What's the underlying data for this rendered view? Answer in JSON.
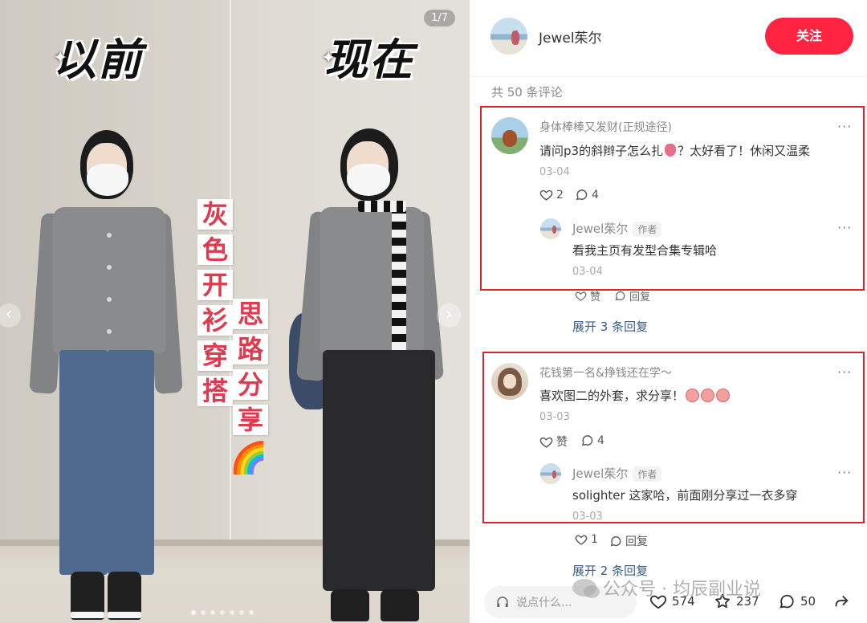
{
  "image": {
    "label_left": "以前",
    "label_right": "现在",
    "counter": "1/7",
    "vertical_col1": [
      "灰",
      "色",
      "开",
      "衫",
      "穿",
      "搭"
    ],
    "vertical_col2": [
      "思",
      "路",
      "分",
      "享"
    ],
    "rainbow": "🌈",
    "prev_arrow": "‹",
    "next_arrow": "›"
  },
  "header": {
    "author": "Jewel茱尔",
    "follow_label": "关注"
  },
  "comments_total": "共 50 条评论",
  "comments": [
    {
      "user": "身体棒棒又发财(正规途径)",
      "text_before": "请问p3的斜辫子怎么扎",
      "text_after": "？太好看了！休闲又温柔",
      "date": "03-04",
      "likes": "2",
      "replies": "4",
      "more": "···",
      "reply": {
        "user": "Jewel茱尔",
        "tag": "作者",
        "text": "看我主页有发型合集专辑哈",
        "date": "03-04",
        "like_label": "赞",
        "reply_label": "回复",
        "more": "···"
      },
      "expand": "展开 3 条回复"
    },
    {
      "user": "花钱第一名&挣钱还在学～",
      "text": "喜欢图二的外套，求分享！",
      "date": "03-03",
      "like_label": "赞",
      "replies": "4",
      "more": "···",
      "reply": {
        "user": "Jewel茱尔",
        "tag": "作者",
        "text": "solighter 这家哈，前面刚分享过一衣多穿",
        "date": "03-03",
        "likes": "1",
        "reply_label": "回复",
        "more": "···"
      },
      "expand": "展开 2 条回复"
    }
  ],
  "bottom": {
    "placeholder": "说点什么...",
    "likes": "574",
    "stars": "237",
    "comments": "50"
  },
  "watermark": "公众号 · 均辰副业说",
  "colors": {
    "accent": "#ff2442",
    "highlight_box": "#e0222a",
    "link": "#3a5c8a"
  }
}
